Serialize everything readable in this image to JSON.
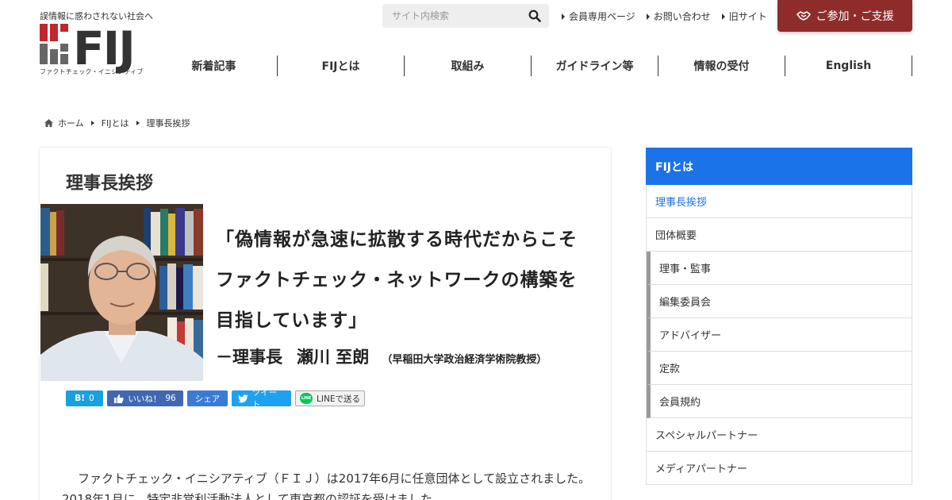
{
  "header": {
    "tagline": "誤情報に惑わされない社会へ",
    "logo_text": "FIJ",
    "logo_sub": "ファクトチェック・イニシアティブ",
    "search_placeholder": "サイト内検索",
    "top_links": [
      {
        "label": "会員専用ページ"
      },
      {
        "label": "お問い合わせ"
      },
      {
        "label": "旧サイト"
      }
    ],
    "join_label": "ご参加・ご支援",
    "nav": [
      {
        "label": "新着記事"
      },
      {
        "label": "FIJとは"
      },
      {
        "label": "取組み"
      },
      {
        "label": "ガイドライン等"
      },
      {
        "label": "情報の受付"
      },
      {
        "label": "English"
      }
    ]
  },
  "breadcrumb": [
    {
      "label": "ホーム"
    },
    {
      "label": "FIJとは"
    },
    {
      "label": "理事長挨拶"
    }
  ],
  "main": {
    "title": "理事長挨拶",
    "quote_lines": [
      "「偽情報が急速に拡散する時代だからこそ",
      "ファクトチェック・ネットワークの構築を",
      "目指しています」"
    ],
    "sign_role": "－理事長",
    "sign_name": "瀬川 至朗",
    "sign_affiliation": "（早稲田大学政治経済学術院教授）",
    "share": {
      "hatena_label": "B!",
      "hatena_count": "0",
      "fb_like_label": "いいね！",
      "fb_like_count": "96",
      "fb_share_label": "シェア",
      "tweet_label": "ツイート",
      "line_label": "LINEで送る",
      "line_icon_text": "LINE"
    },
    "body_text": "ファクトチェック・イニシアティブ（ＦＩＪ）は2017年6月に任意団体として設立されました。2018年1月に、特定非営利活動法人として東京都の認証を受けました。"
  },
  "sidebar": {
    "heading": "FIJとは",
    "items": [
      {
        "label": "理事長挨拶"
      },
      {
        "label": "団体概要"
      },
      {
        "label": "理事・監事"
      },
      {
        "label": "編集委員会"
      },
      {
        "label": "アドバイザー"
      },
      {
        "label": "定款"
      },
      {
        "label": "会員規約"
      },
      {
        "label": "スペシャルパートナー"
      },
      {
        "label": "メディアパートナー"
      }
    ]
  },
  "colors": {
    "accent_red": "#8e2c2c",
    "sidebar_blue": "#1a73e8",
    "logo_red": "#c0282d",
    "logo_gray": "#555555"
  }
}
